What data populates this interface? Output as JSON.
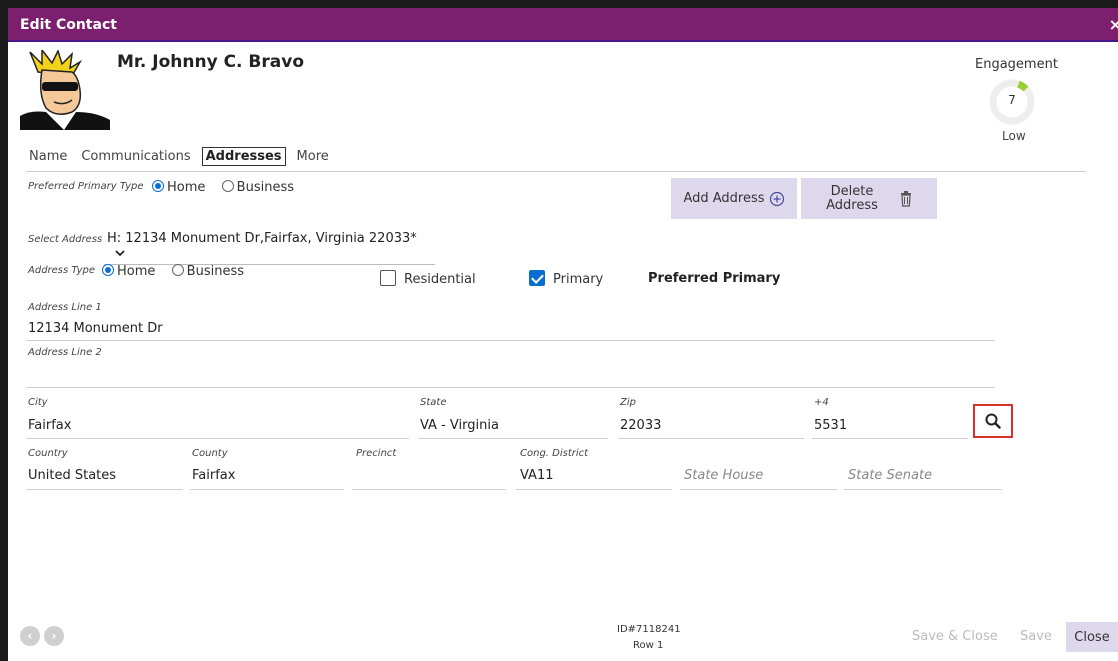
{
  "window": {
    "title": "Edit Contact",
    "close_glyph": "×"
  },
  "contact": {
    "name": "Mr. Johnny C. Bravo"
  },
  "engagement": {
    "label": "Engagement",
    "value": "7",
    "level": "Low"
  },
  "tabs": [
    {
      "label": "Name"
    },
    {
      "label": "Communications"
    },
    {
      "label": "Addresses"
    },
    {
      "label": "More"
    }
  ],
  "preferred_type": {
    "label": "Preferred Primary Type",
    "opt1": "Home",
    "opt2": "Business"
  },
  "actions": {
    "add": "Add Address",
    "delete_line1": "Delete",
    "delete_line2": "Address"
  },
  "select_address": {
    "label": "Select Address",
    "value": "H: 12134 Monument Dr,Fairfax, Virginia 22033*"
  },
  "address_type": {
    "label": "Address Type",
    "opt1": "Home",
    "opt2": "Business"
  },
  "flags": {
    "residential": "Residential",
    "primary": "Primary",
    "preferred_primary": "Preferred Primary"
  },
  "fields": {
    "line1_label": "Address Line 1",
    "line1_value": "12134 Monument Dr",
    "line2_label": "Address Line 2",
    "line2_value": "",
    "city_label": "City",
    "city_value": "Fairfax",
    "state_label": "State",
    "state_value": "VA - Virginia",
    "zip_label": "Zip",
    "zip_value": "22033",
    "plus4_label": "+4",
    "plus4_value": "5531",
    "country_label": "Country",
    "country_value": "United States",
    "county_label": "County",
    "county_value": "Fairfax",
    "precinct_label": "Precinct",
    "precinct_value": "",
    "cong_label": "Cong. District",
    "cong_value": "VA11",
    "state_house_placeholder": "State House",
    "state_senate_placeholder": "State Senate"
  },
  "footer": {
    "id": "ID#7118241",
    "row": "Row 1",
    "save_close": "Save & Close",
    "save": "Save",
    "close": "Close",
    "prev_glyph": "‹",
    "next_glyph": "›"
  },
  "colors": {
    "titlebar": "#7b1f6e",
    "accent": "#0a6ed1",
    "highlight": "#d9302c",
    "button": "#ddd8ec"
  }
}
